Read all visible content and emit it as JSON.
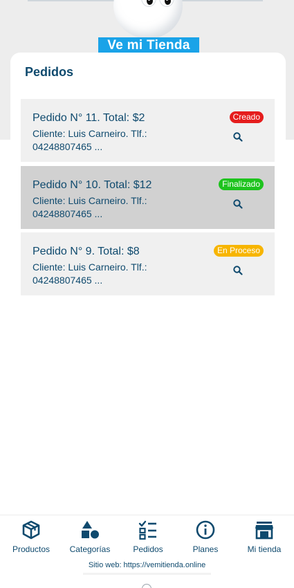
{
  "logo": {
    "text": "Ve mi Tienda"
  },
  "page": {
    "title": "Pedidos"
  },
  "orders": [
    {
      "heading": "Pedido N° 11. Total: $2",
      "client": "Cliente: Luis Carneiro. Tlf.: 04248807465 ...",
      "status": "Creado",
      "status_color": "#e51d1d",
      "selected": false
    },
    {
      "heading": "Pedido N° 10. Total: $12",
      "client": "Cliente: Luis Carneiro. Tlf.: 04248807465 ...",
      "status": "Finalizado",
      "status_color": "#1ec31e",
      "selected": true
    },
    {
      "heading": "Pedido N° 9. Total: $8",
      "client": "Cliente: Luis Carneiro. Tlf.: 04248807465 ...",
      "status": "En Proceso",
      "status_color": "#f7b500",
      "selected": false
    }
  ],
  "nav": [
    {
      "label": "Productos",
      "icon": "box-icon"
    },
    {
      "label": "Categorías",
      "icon": "shapes-icon"
    },
    {
      "label": "Pedidos",
      "icon": "checklist-icon"
    },
    {
      "label": "Planes",
      "icon": "info-icon"
    },
    {
      "label": "Mi tienda",
      "icon": "store-icon"
    }
  ],
  "footer": {
    "website": "Sitio web: https://vemitienda.online"
  },
  "colors": {
    "primary": "#0f4a6e",
    "logo_bg": "#1aa3e8",
    "card_bg": "#f0f0f0",
    "selected_bg": "#d1d1d1"
  }
}
